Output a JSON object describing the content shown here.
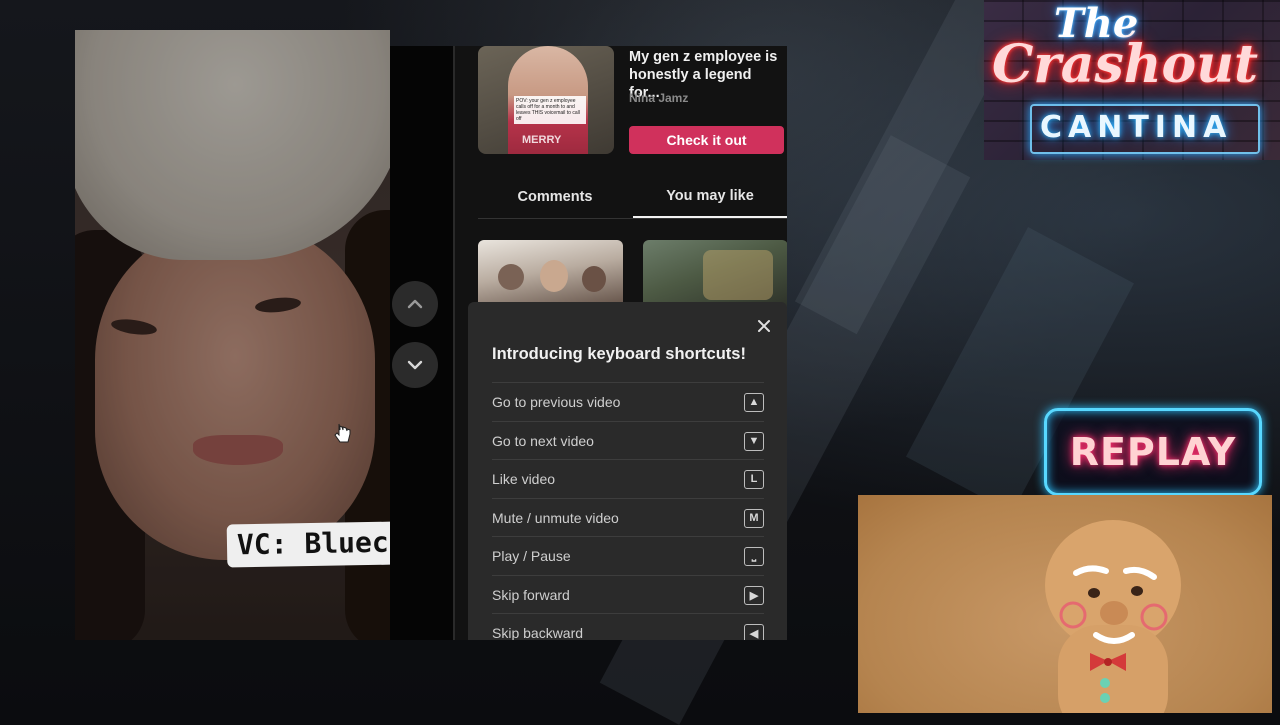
{
  "video": {
    "overlay_text": "VC: Bluecatclurb"
  },
  "promo": {
    "thumb_caption": "POV: your gen z employee calls off for a month to and leaves THIS voicemail to call off",
    "thumb_sweater": "MERRY",
    "title": "My gen z employee is honestly a legend for...",
    "author": "Nina Jamz",
    "button": "Check it out"
  },
  "tabs": [
    {
      "label": "Comments",
      "active": false
    },
    {
      "label": "You may like",
      "active": true
    }
  ],
  "shortcuts_popup": {
    "title": "Introducing keyboard shortcuts!",
    "items": [
      {
        "label": "Go to previous video",
        "key": "▲"
      },
      {
        "label": "Go to next video",
        "key": "▼"
      },
      {
        "label": "Like video",
        "key": "L"
      },
      {
        "label": "Mute / unmute video",
        "key": "M"
      },
      {
        "label": "Play / Pause",
        "key": "⎵"
      },
      {
        "label": "Skip forward",
        "key": "▶"
      },
      {
        "label": "Skip backward",
        "key": "◀"
      }
    ]
  },
  "logo": {
    "line1": "The",
    "line2": "Crashout",
    "line3": "CANTINA"
  },
  "replay_label": "REPLAY",
  "colors": {
    "accent_pink": "#d0315c",
    "neon_red": "#ff2a2a",
    "neon_blue": "#2cc3ff",
    "panel_bg": "#121212",
    "popup_bg": "#2a2a2a"
  },
  "icons": [
    "chevron-up-icon",
    "chevron-down-icon",
    "close-icon",
    "cursor-icon"
  ]
}
